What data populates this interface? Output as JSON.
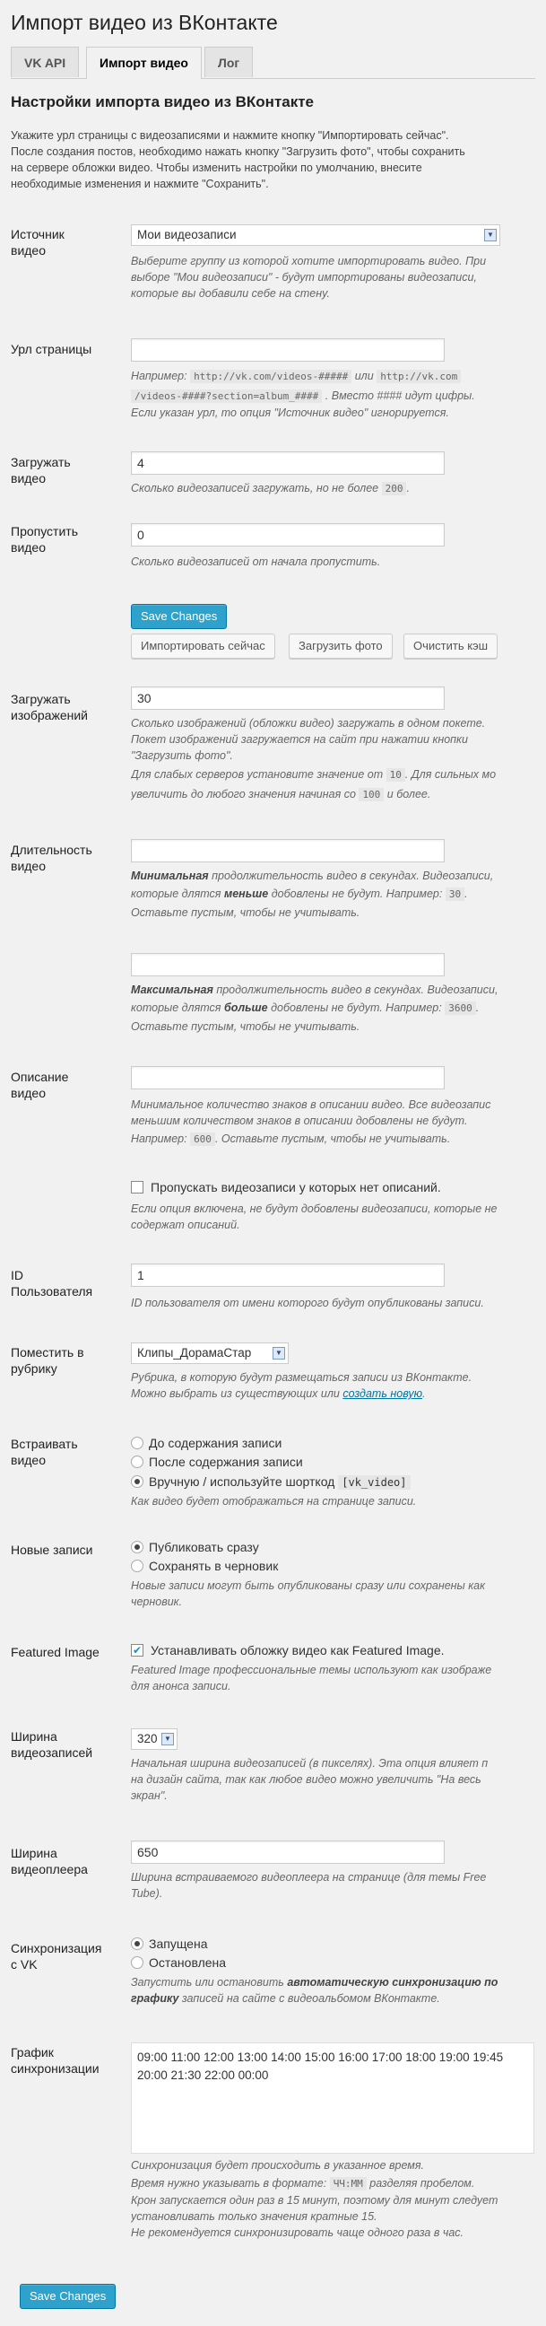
{
  "page_title": "Импорт видео из ВКонтакте",
  "tabs": [
    "VK API",
    "Импорт видео",
    "Лог"
  ],
  "active_tab": 1,
  "section_title": "Настройки импорта видео из ВКонтакте",
  "intro": [
    "Укажите урл страницы с видеозаписями и нажмите кнопку \"Импортировать сейчас\".",
    "После создания постов, необходимо нажать кнопку \"Загрузить фото\", чтобы сохранить",
    "на сервере обложки видео. Чтобы изменить настройки по умолчанию, внесите",
    "необходимые изменения и нажмите \"Сохранить\"."
  ],
  "source": {
    "label": [
      "Источник",
      "видео"
    ],
    "value": "Мои видеозаписи",
    "desc": [
      "Выберите группу из которой хотите импортировать видео. При",
      "выборе \"Мои видеозаписи\" - будут импортированы видеозаписи,",
      "которые вы добавили себе на стену."
    ]
  },
  "url": {
    "label": [
      "Урл страницы"
    ],
    "value": "",
    "desc_pre": "Например:",
    "code1": "http://vk.com/videos-#####",
    "or": "или",
    "code2": "http://vk.com",
    "code3": "/videos-####?section=album_####",
    "desc_mid": ". Вместо #### идут цифры.",
    "desc_last": "Если указан урл, то опция \"Источник видео\" игнорируется."
  },
  "load_video": {
    "label": [
      "Загружать",
      "видео"
    ],
    "value": "4",
    "desc_pre": "Сколько видеозаписей загружать, но не более",
    "code": "200",
    "desc_post": "."
  },
  "skip_video": {
    "label": [
      "Пропустить",
      "видео"
    ],
    "value": "0",
    "desc": "Сколько видеозаписей от начала пропустить."
  },
  "buttons": {
    "save": "Save Changes",
    "import_now": "Импортировать сейчас",
    "load_photo": "Загрузить фото",
    "clear_cache": "Очистить кэш"
  },
  "load_images": {
    "label": [
      "Загружать",
      "изображений"
    ],
    "value": "30",
    "desc1": "Сколько изображений (обложки видео) загружать в одном покете.",
    "desc2": "Покет изображений загружается на сайт при нажатии кнопки",
    "desc3": "\"Загрузить фото\".",
    "desc4_pre": "Для слабых серверов установите значение от",
    "code_a": "10",
    "desc4_post": ". Для сильных мо",
    "desc5_pre": "увеличить до любого значения начиная со",
    "code_b": "100",
    "desc5_post": "и более."
  },
  "duration": {
    "label": [
      "Длительность",
      "видео"
    ],
    "min_value": "",
    "max_value": "",
    "min_b": "Минимальная",
    "min_desc1": "продолжительность видео в секундах. Видеозаписи,",
    "min_desc2_pre": "которые длятся",
    "min_b2": "меньше",
    "min_desc2_mid": "добовлены не будут. Например:",
    "min_code": "30",
    "min_desc2_post": ".",
    "min_desc3": "Оставьте пустым, чтобы не учитывать.",
    "max_b": "Максимальная",
    "max_desc1": "продолжительность видео в секундах. Видеозаписи,",
    "max_desc2_pre": "которые длятся",
    "max_b2": "больше",
    "max_desc2_mid": "добовлены не будут. Например:",
    "max_code": "3600",
    "max_desc2_post": ".",
    "max_desc3": "Оставьте пустым, чтобы не учитывать."
  },
  "description": {
    "label": [
      "Описание",
      "видео"
    ],
    "value": "",
    "desc1": "Минимальное количество знаков в описании видео. Все видеозапис",
    "desc2": "меньшим количеством знаков в описании добовлены не будут.",
    "desc3_pre": "Например:",
    "code": "600",
    "desc3_post": ". Оставьте пустым, чтобы не учитывать.",
    "skip_label": "Пропускать видеозаписи у которых нет описаний.",
    "skip_checked": false,
    "skip_desc1": "Если опция включена, не будут добовлены видеозаписи, которые не",
    "skip_desc2": "содержат описаний."
  },
  "user_id": {
    "label": [
      "ID",
      "Пользователя"
    ],
    "value": "1",
    "desc": "ID пользователя от имени которого будут опубликованы записи."
  },
  "category": {
    "label": [
      "Поместить в",
      "рубрику"
    ],
    "value": "Клипы_ДорамаСтар",
    "desc1": "Рубрика, в которую будут размещаться записи из ВКонтакте.",
    "desc2_pre": "Можно выбрать из существующих или",
    "link": "создать новую",
    "desc2_post": "."
  },
  "embed": {
    "label": [
      "Встраивать",
      "видео"
    ],
    "options": [
      "До содержания записи",
      "После содержания записи",
      "Вручную / используйте шорткод"
    ],
    "shortcode": "[vk_video]",
    "selected": 2,
    "desc": "Как видео будет отображаться на странице записи."
  },
  "new_posts": {
    "label": [
      "Новые записи"
    ],
    "options": [
      "Публиковать сразу",
      "Сохранять в черновик"
    ],
    "selected": 0,
    "desc1": "Новые записи могут быть опубликованы сразу или сохранены как",
    "desc2": "черновик."
  },
  "featured": {
    "label": [
      "Featured Image"
    ],
    "checkbox_label": "Устанавливать обложку видео как Featured Image.",
    "checked": true,
    "desc1": "Featured Image профессиональные темы используют как изображе",
    "desc2": "для анонса записи."
  },
  "video_width": {
    "label": [
      "Ширина",
      "видеозаписей"
    ],
    "value": "320",
    "desc1": "Начальная ширина видеозаписей (в пикселях). Эта опция влияет п",
    "desc2": "на дизайн сайта, так как любое видео можно увеличить \"На весь",
    "desc3": "экран\"."
  },
  "player_width": {
    "label": [
      "Ширина",
      "видеоплеера"
    ],
    "value": "650",
    "desc1": "Ширина встраиваемого видеоплеера на странице (для темы Free",
    "desc2": "Tube)."
  },
  "sync": {
    "label": [
      "Синхронизация",
      "с VK"
    ],
    "options": [
      "Запущена",
      "Остановлена"
    ],
    "selected": 0,
    "desc1": "Запустить или остановить",
    "desc1_b": "автоматическую синхронизацию по",
    "desc2_b": "графику",
    "desc2": "записей на сайте с видеоальбомом ВКонтакте."
  },
  "schedule": {
    "label": [
      "График",
      "синхронизации"
    ],
    "line1": "09:00 11:00 12:00 13:00 14:00 15:00 16:00 17:00 18:00 19:00 19:45",
    "line2": "20:00 21:30 22:00 00:00",
    "desc1": "Синхронизация будет происходить в указанное время.",
    "desc2_pre": "Время нужно указывать в формате:",
    "code": "ЧЧ:ММ",
    "desc2_post": "разделяя пробелом.",
    "desc3": "Крон запускается один раз в 15 минут, поэтому для минут следует",
    "desc4": "установливать только значения кратные 15.",
    "desc5": "Не рекомендуется синхронизировать чаще одного раза в час."
  }
}
